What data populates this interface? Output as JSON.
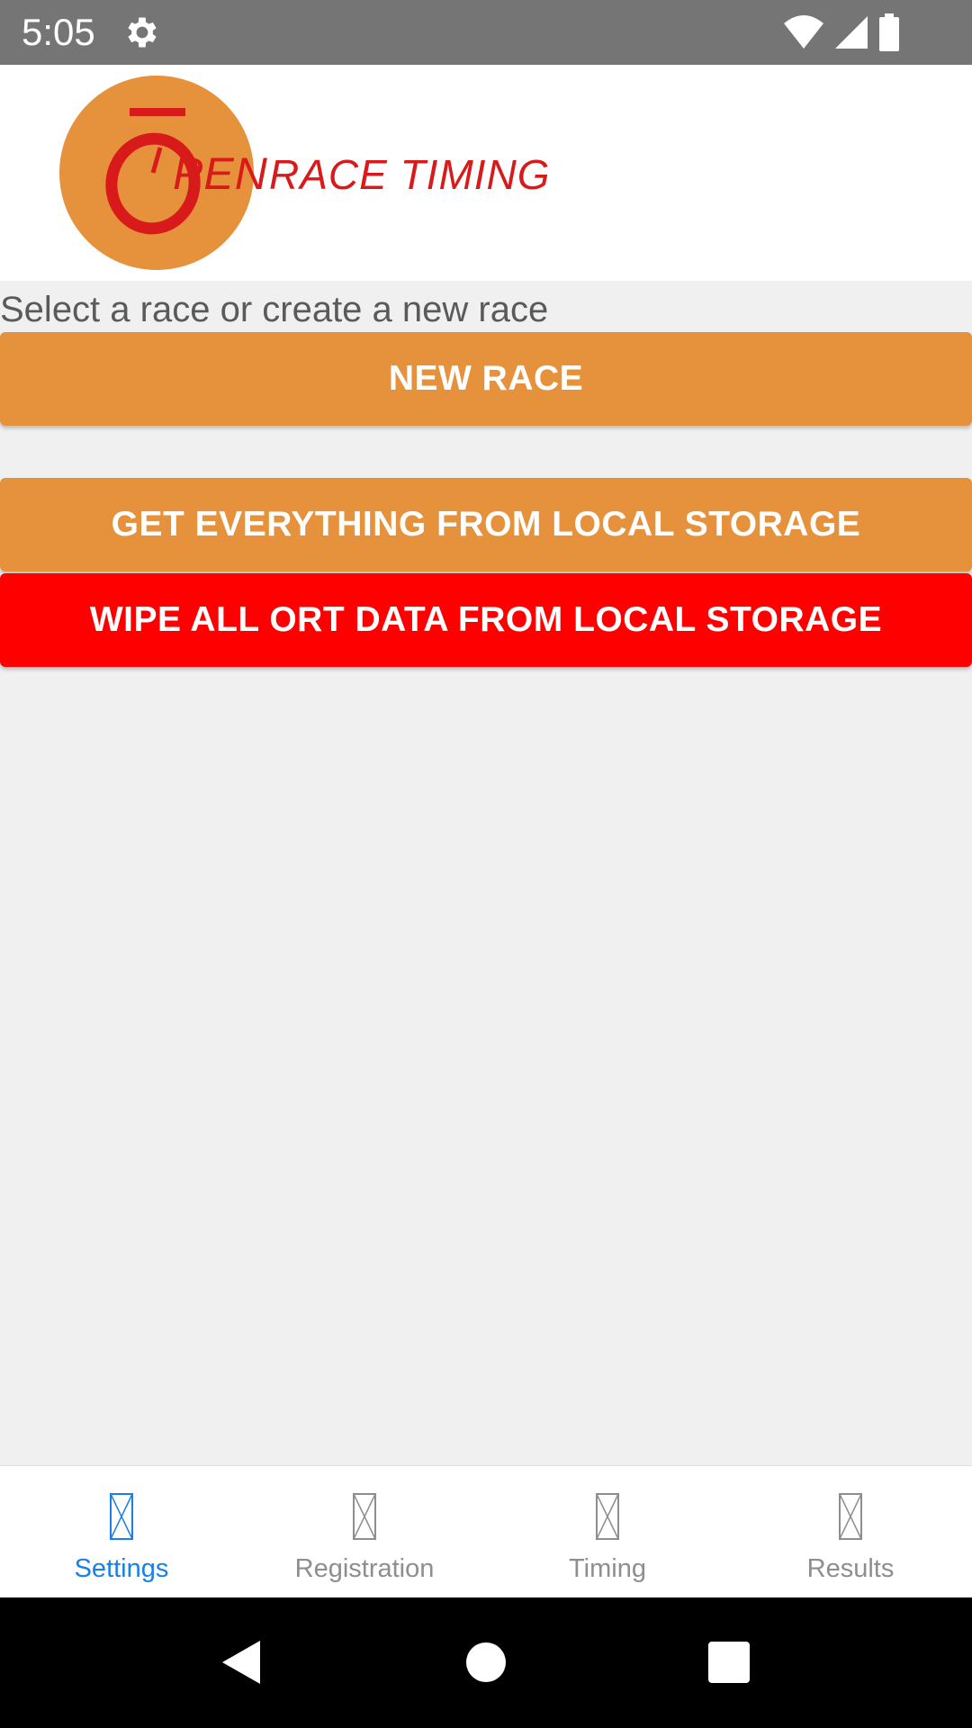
{
  "status_bar": {
    "time": "5:05",
    "icons": [
      "gear-icon",
      "wifi-icon",
      "signal-icon",
      "battery-icon"
    ]
  },
  "header": {
    "logo_text": "OPEN RACE TIMING",
    "logo_colors": {
      "circle": "#e6913b",
      "text": "#d81a1a"
    }
  },
  "main": {
    "prompt": "Select a race or create a new race",
    "new_race_label": "NEW RACE",
    "get_all_label": "GET EVERYTHING FROM LOCAL STORAGE",
    "wipe_label": "WIPE ALL ORT DATA FROM LOCAL STORAGE"
  },
  "tabs": [
    {
      "label": "Settings",
      "active": true,
      "icon": "missing-glyph-icon"
    },
    {
      "label": "Registration",
      "active": false,
      "icon": "missing-glyph-icon"
    },
    {
      "label": "Timing",
      "active": false,
      "icon": "missing-glyph-icon"
    },
    {
      "label": "Results",
      "active": false,
      "icon": "missing-glyph-icon"
    }
  ],
  "colors": {
    "accent_orange": "#e6913b",
    "danger_red": "#ff0000",
    "tab_active": "#1a7fe6",
    "tab_inactive": "#8e8e8e",
    "status_bar": "#757575"
  },
  "nav_bar": {
    "icons": [
      "back-icon",
      "home-icon",
      "recents-icon"
    ]
  }
}
